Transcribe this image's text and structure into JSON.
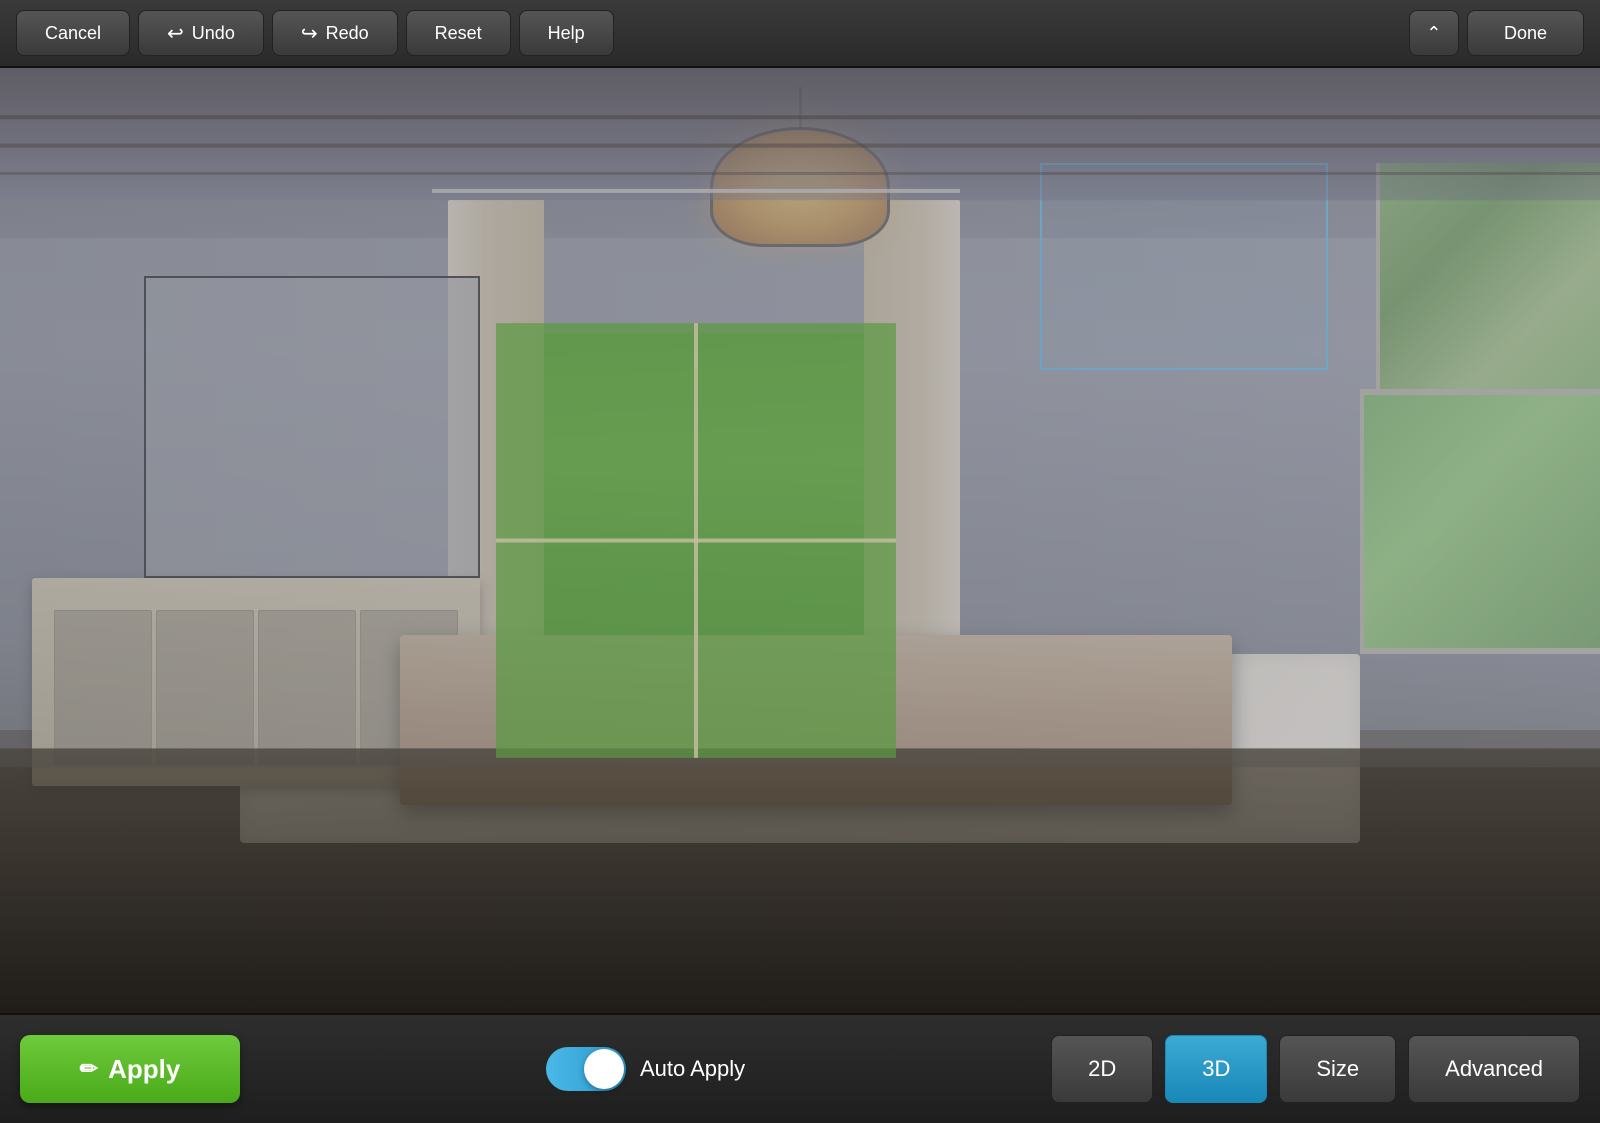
{
  "toolbar": {
    "cancel_label": "Cancel",
    "undo_label": "Undo",
    "redo_label": "Redo",
    "reset_label": "Reset",
    "help_label": "Help",
    "done_label": "Done",
    "chevron_up": "^"
  },
  "bottom_bar": {
    "apply_label": "Apply",
    "auto_apply_label": "Auto Apply",
    "mode_2d_label": "2D",
    "mode_3d_label": "3D",
    "size_label": "Size",
    "advanced_label": "Advanced",
    "toggle_on": true
  },
  "scene": {
    "wall_frame_description": "Wall art placeholder frame",
    "blue_selection_description": "Selected area on wall",
    "window_description": "Exterior view through windows"
  },
  "colors": {
    "apply_green": "#4aaa18",
    "apply_green_light": "#6ecb3c",
    "toggle_blue": "#4ab8e8",
    "mode_active_blue": "#1a88b8",
    "toolbar_bg": "#2e2e2e",
    "button_bg": "#444444",
    "text_white": "#ffffff"
  }
}
